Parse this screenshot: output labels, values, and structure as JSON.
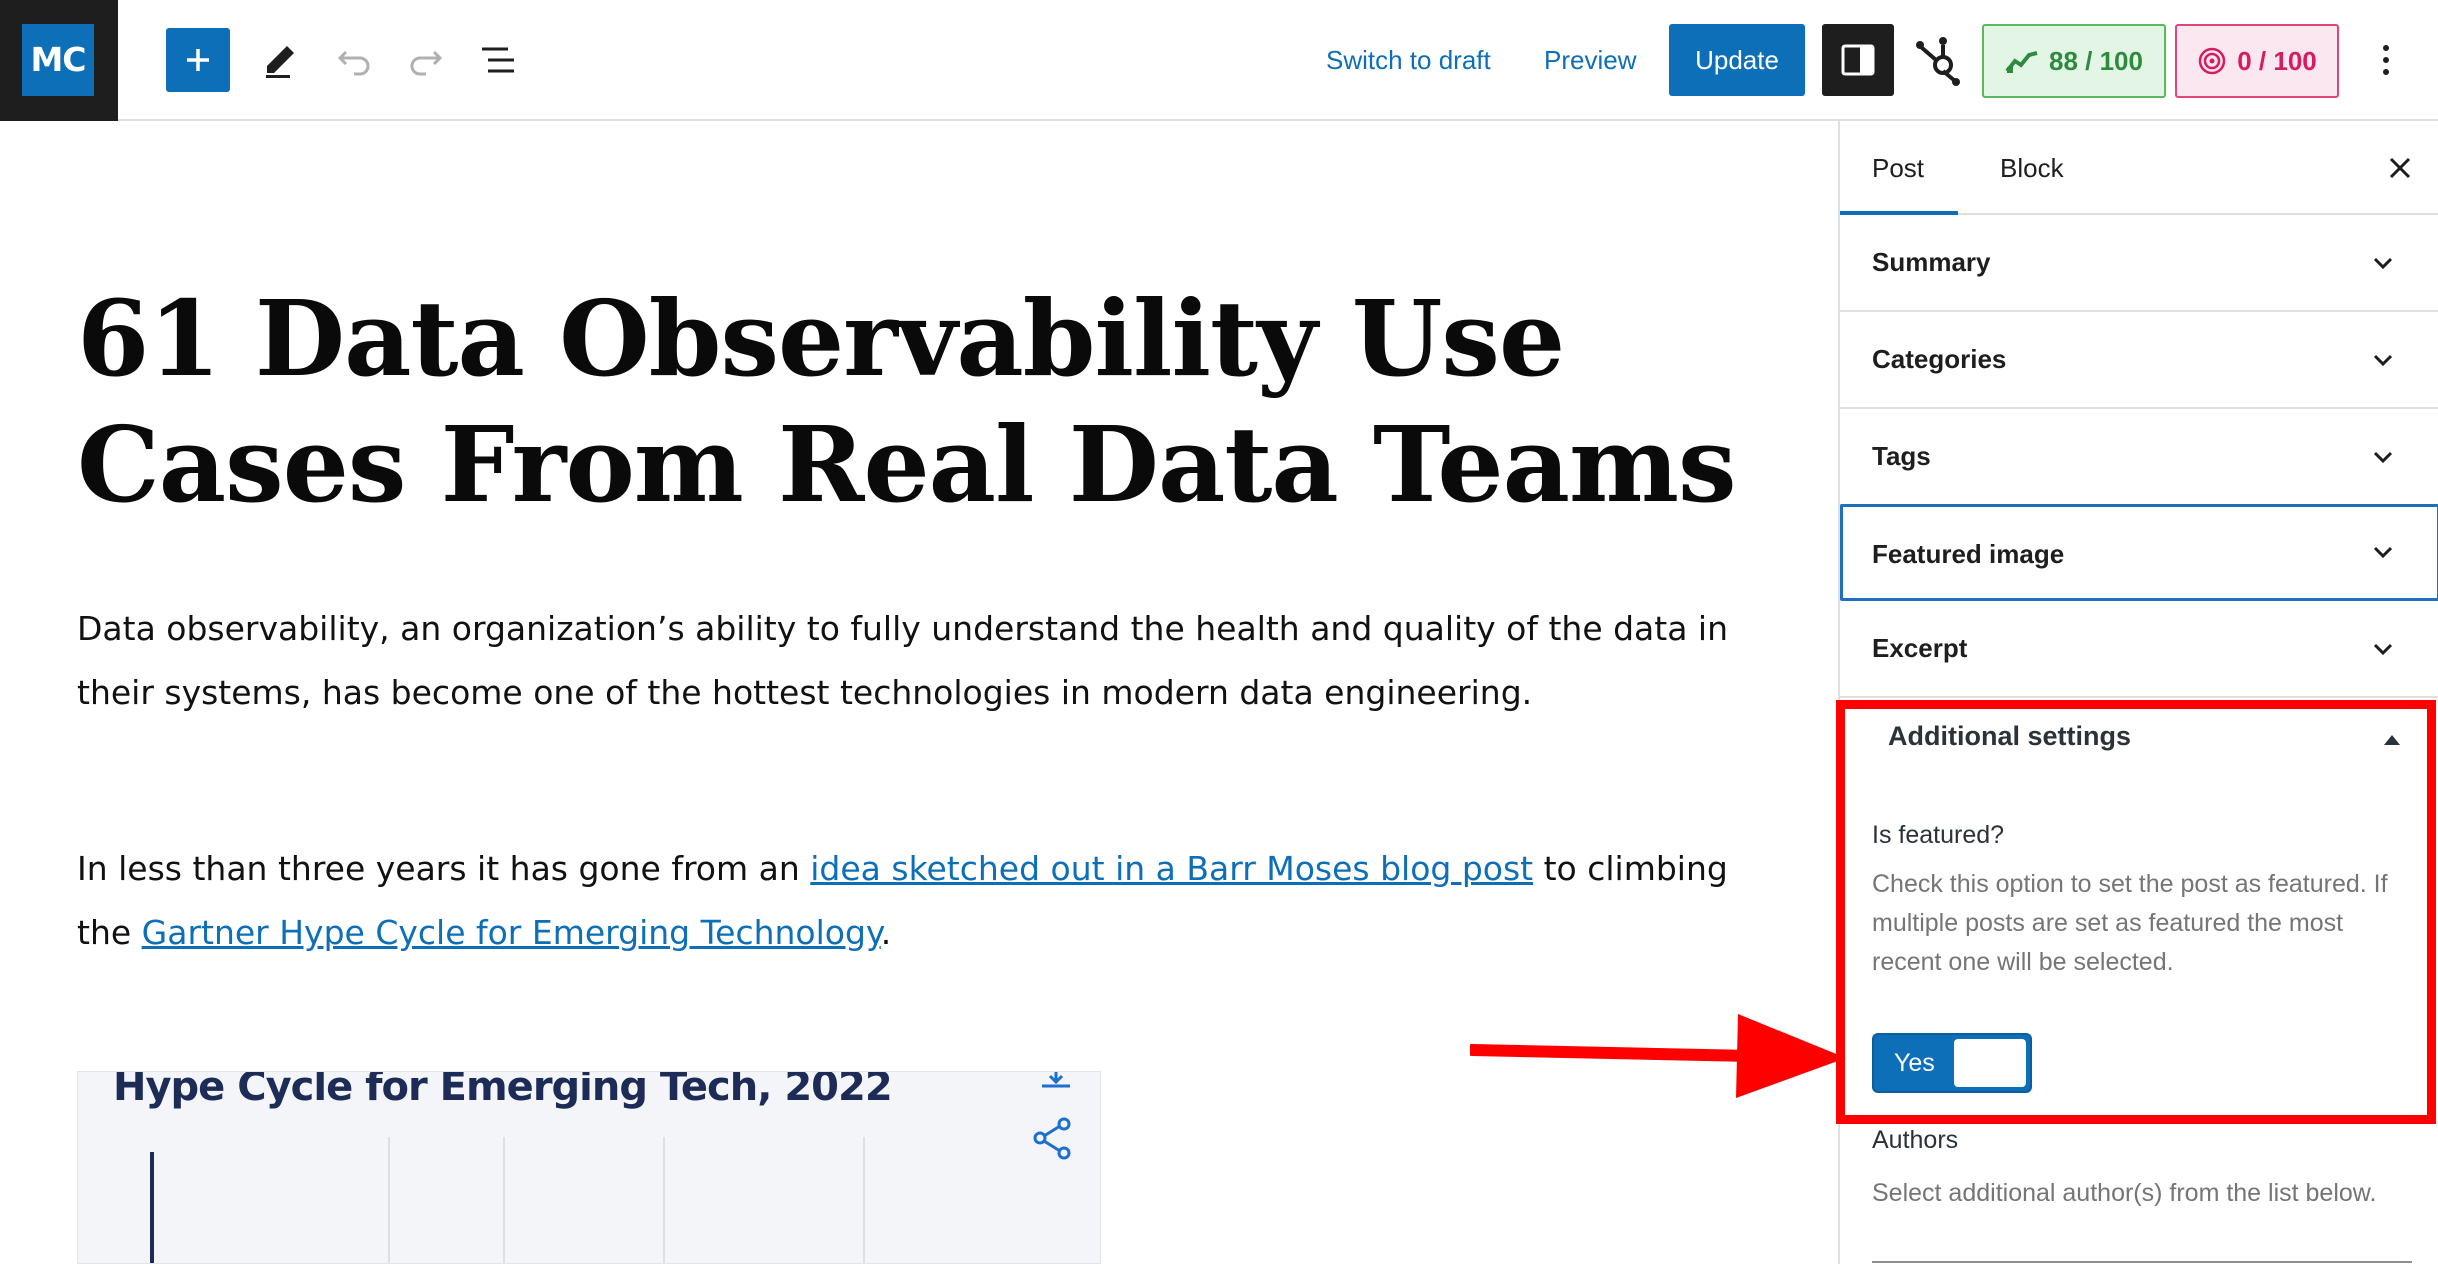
{
  "topbar": {
    "logo_text": "MC",
    "icons": [
      "plus-icon",
      "pencil-icon",
      "undo-icon",
      "redo-icon",
      "list-view-icon",
      "sidebar-toggle-icon",
      "hubspot-icon",
      "kebab-menu-icon"
    ],
    "switch_to_draft": "Switch to draft",
    "preview": "Preview",
    "update": "Update",
    "seo_score": "88 / 100",
    "readability_score": "0 / 100",
    "colors": {
      "accent": "#0d6fb8",
      "dark": "#1e1e1e",
      "score_green": "#2e8b3e",
      "score_red": "#d81b60"
    }
  },
  "editor": {
    "title": "61 Data Observability Use Cases From Real Data Teams",
    "paragraph1": "Data observability, an organization’s ability to fully understand the health and quality of the data in their systems, has become one of the hottest technologies in modern data engineering.",
    "paragraph2": {
      "before": "In less than three years it has gone from an ",
      "link1": "idea sketched out in a Barr Moses blog post",
      "middle": " to climbing the ",
      "link2": "Gartner Hype Cycle for Emerging Technology",
      "after": "."
    },
    "embed": {
      "title": "Hype Cycle for Emerging Tech, 2022",
      "icons": [
        "download-icon",
        "share-icon"
      ]
    }
  },
  "sidebar": {
    "tabs": [
      "Post",
      "Block"
    ],
    "active_tab": "Post",
    "panels": [
      "Summary",
      "Categories",
      "Tags",
      "Featured image",
      "Excerpt"
    ],
    "additional_settings": {
      "title": "Additional settings",
      "is_featured_label": "Is featured?",
      "is_featured_help": "Check this option to set the post as featured. If multiple posts are set as featured the most recent one will be selected.",
      "toggle_label": "Yes",
      "authors_label": "Authors",
      "authors_help": "Select additional author(s) from the list below."
    }
  },
  "annotation": {
    "color": "#ff0000"
  }
}
